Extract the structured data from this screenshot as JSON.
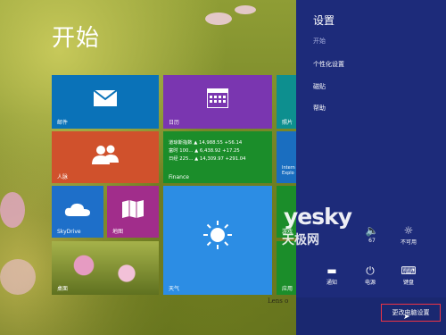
{
  "start": {
    "title": "开始"
  },
  "tiles": {
    "mail": "邮件",
    "calendar": "日历",
    "photos": "照片",
    "people": "人脉",
    "finance": "Finance",
    "finance_rows": [
      {
        "name": "道琼斯指数",
        "value": "▲ 14,988.55 +56.14"
      },
      {
        "name": "富时 100...",
        "value": "▲ 6,438.92 +17.25"
      },
      {
        "name": "日经 225...",
        "value": "▲ 14,309.97 +291.04"
      }
    ],
    "ie": "Intern Explo",
    "skydrive": "SkyDrive",
    "maps": "地图",
    "weather": "天气",
    "games": "游戏",
    "desktop": "桌面",
    "app": "应用"
  },
  "charm": {
    "title": "设置",
    "subtitle": "开始",
    "links": [
      "个性化设置",
      "磁贴",
      "帮助"
    ],
    "quick": [
      {
        "icon": "volume-icon",
        "glyph": "🔈",
        "label": "67"
      },
      {
        "icon": "brightness-icon",
        "glyph": "☼",
        "label": "不可用"
      },
      {
        "icon": "notifications-icon",
        "glyph": "▬",
        "label": "通知"
      },
      {
        "icon": "power-icon",
        "glyph": "⏻",
        "label": "电源"
      },
      {
        "icon": "keyboard-icon",
        "glyph": "⌨",
        "label": "键盘"
      }
    ],
    "change_pc_settings": "更改电脑设置"
  },
  "watermark": {
    "brand": "yesky",
    "brand_cn": "天极网",
    "lens": "Lens o"
  }
}
